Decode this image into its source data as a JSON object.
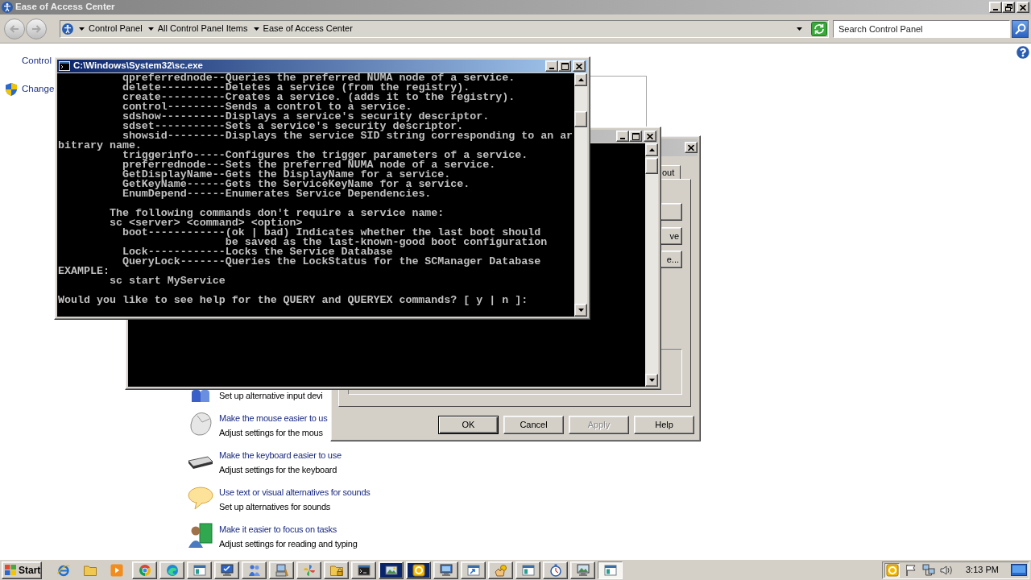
{
  "explorer": {
    "title": "Ease of Access Center",
    "active": false,
    "back": {
      "disabled": true
    },
    "forward": {
      "disabled": true
    },
    "breadcrumb": [
      "Control Panel",
      "All Control Panel Items",
      "Ease of Access Center"
    ],
    "search": {
      "placeholder": "Search Control Panel"
    },
    "nav_links": [
      {
        "kind": "plain",
        "text": "Control"
      },
      {
        "kind": "shield",
        "text": "Change"
      }
    ],
    "tasks": [
      {
        "kind": "input",
        "description": "Set up alternative input devi"
      },
      {
        "kind": "mouse",
        "link": "Make the mouse easier to us",
        "description": "Adjust settings for the mous"
      },
      {
        "kind": "keyboard",
        "link": "Make the keyboard easier to use",
        "description": "Adjust settings for the keyboard"
      },
      {
        "kind": "sound",
        "link": "Use text or visual alternatives for sounds",
        "description": "Set up alternatives for sounds"
      },
      {
        "kind": "focus",
        "link": "Make it easier to focus on tasks",
        "description": "Adjust settings for reading and typing"
      }
    ]
  },
  "dialog": {
    "active": false,
    "tab": "out",
    "side_buttons": [
      {
        "kind": "blank"
      },
      {
        "kind": "label",
        "label": "ve"
      },
      {
        "kind": "label",
        "label": "e..."
      }
    ],
    "buttons": [
      {
        "label": "OK",
        "default": true,
        "disabled": false
      },
      {
        "label": "Cancel",
        "default": false,
        "disabled": false
      },
      {
        "label": "Apply",
        "default": false,
        "disabled": true
      },
      {
        "label": "Help",
        "default": false,
        "disabled": false
      }
    ]
  },
  "consoles": [
    {
      "title": "C:\\Windows\\System32\\sc.exe",
      "active": true,
      "blocks": [
        [
          "          qpreferrednode--Queries the preferred NUMA node of a service.",
          "          delete----------Deletes a service (from the registry).",
          "          create----------Creates a service. (adds it to the registry).",
          "          control---------Sends a control to a service.",
          "          sdshow----------Displays a service's security descriptor.",
          "          sdset-----------Sets a service's security descriptor.",
          "          showsid---------Displays the service SID string corresponding to an ar",
          "bitrary name.",
          "          triggerinfo-----Configures the trigger parameters of a service.",
          "          preferrednode---Sets the preferred NUMA node of a service.",
          "          GetDisplayName--Gets the DisplayName for a service.",
          "          GetKeyName------Gets the ServiceKeyName for a service.",
          "          EnumDepend------Enumerates Service Dependencies."
        ],
        [
          "        The following commands don't require a service name:",
          "        sc <server> <command> <option>",
          "          boot------------(ok | bad) Indicates whether the last boot should",
          "                          be saved as the last-known-good boot configuration",
          "          Lock------------Locks the Service Database",
          "          QueryLock-------Queries the LockStatus for the SCManager Database",
          "EXAMPLE:",
          "        sc start MyService"
        ],
        [
          "Would you like to see help for the QUERY and QUERYEX commands? [ y | n ]:"
        ]
      ]
    },
    {
      "active": false
    }
  ],
  "taskbar": {
    "start": "Start",
    "quick_launch": [
      {
        "kind": "browser-e"
      },
      {
        "kind": "folder"
      },
      {
        "kind": "play"
      }
    ],
    "buttons": [
      {
        "kind": "browser-ring",
        "flashing": false,
        "active": false
      },
      {
        "kind": "browser-wave",
        "flashing": false,
        "active": false
      },
      {
        "kind": "window",
        "flashing": false,
        "active": false
      },
      {
        "kind": "monitor-check",
        "flashing": false,
        "active": false
      },
      {
        "kind": "users",
        "flashing": false,
        "active": false
      },
      {
        "kind": "computer-tools",
        "flashing": false,
        "active": false
      },
      {
        "kind": "pinwheel",
        "flashing": false,
        "active": false
      },
      {
        "kind": "folder-lock",
        "flashing": false,
        "active": false
      },
      {
        "kind": "terminal",
        "flashing": false,
        "active": false
      },
      {
        "kind": "scanner",
        "flashing": true,
        "active": false
      },
      {
        "kind": "coin",
        "flashing": true,
        "active": false
      },
      {
        "kind": "monitor",
        "flashing": false,
        "active": false
      },
      {
        "kind": "window-arrow",
        "flashing": false,
        "active": false
      },
      {
        "kind": "hand",
        "flashing": false,
        "active": false
      },
      {
        "kind": "window",
        "flashing": false,
        "active": false
      },
      {
        "kind": "stopwatch",
        "flashing": false,
        "active": false
      },
      {
        "kind": "monitor-photo",
        "flashing": false,
        "active": false
      },
      {
        "kind": "window",
        "flashing": false,
        "active": true
      }
    ],
    "tray": [
      {
        "kind": "coin"
      },
      {
        "kind": "flag"
      },
      {
        "kind": "network"
      },
      {
        "kind": "speaker"
      }
    ],
    "clock": "3:13 PM"
  }
}
